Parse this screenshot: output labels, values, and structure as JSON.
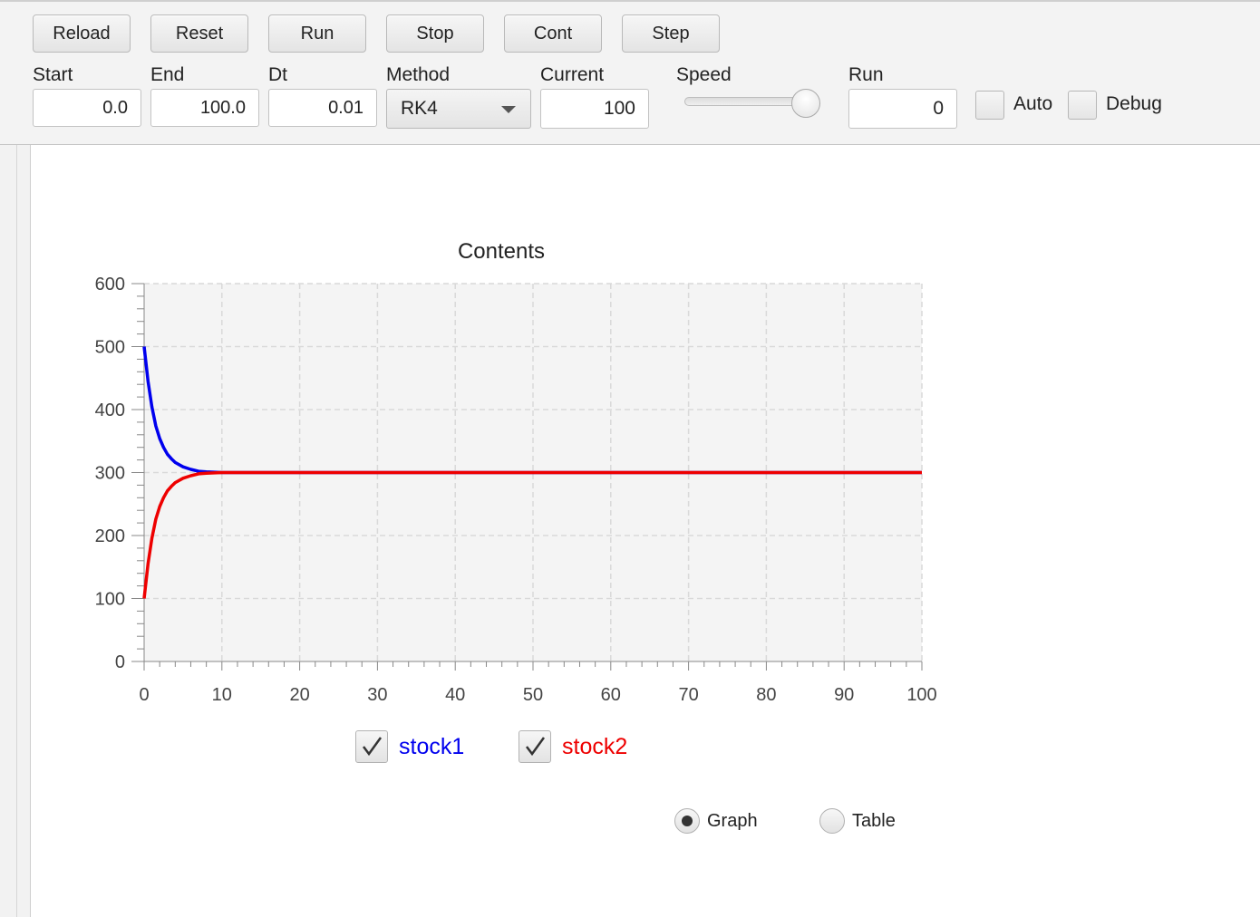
{
  "toolbar": {
    "buttons": [
      "Reload",
      "Reset",
      "Run",
      "Stop",
      "Cont",
      "Step"
    ],
    "labels": {
      "start": "Start",
      "end": "End",
      "dt": "Dt",
      "method": "Method",
      "current": "Current",
      "speed": "Speed",
      "run": "Run"
    },
    "values": {
      "start": "0.0",
      "end": "100.0",
      "dt": "0.01",
      "method": "RK4",
      "current": "100",
      "run": "0"
    },
    "speed_level": 1.0,
    "auto_label": "Auto",
    "debug_label": "Debug",
    "auto_checked": false,
    "debug_checked": false
  },
  "chart_data": {
    "type": "line",
    "title": "Contents",
    "xlabel": "",
    "ylabel": "",
    "xlim": [
      0,
      100
    ],
    "ylim": [
      0,
      600
    ],
    "xticks": [
      "0",
      "10",
      "20",
      "30",
      "40",
      "50",
      "60",
      "70",
      "80",
      "90",
      "100"
    ],
    "yticks": [
      "0",
      "100",
      "200",
      "300",
      "400",
      "500",
      "600"
    ],
    "grid": true,
    "series": [
      {
        "name": "stock1",
        "color": "#0000ee",
        "x": [
          0,
          0.5,
          1,
          1.5,
          2,
          2.5,
          3,
          3.5,
          4,
          5,
          6,
          7,
          8,
          10,
          12,
          20,
          40,
          60,
          80,
          100
        ],
        "values": [
          500,
          445,
          404,
          374,
          354,
          340,
          329,
          322,
          316,
          309,
          305,
          302,
          301,
          300,
          300,
          300,
          300,
          300,
          300,
          300
        ]
      },
      {
        "name": "stock2",
        "color": "#ee0000",
        "x": [
          0,
          0.5,
          1,
          1.5,
          2,
          2.5,
          3,
          3.5,
          4,
          5,
          6,
          7,
          8,
          10,
          12,
          20,
          40,
          60,
          80,
          100
        ],
        "values": [
          100,
          155,
          196,
          226,
          246,
          260,
          271,
          278,
          284,
          291,
          295,
          298,
          299,
          300,
          300,
          300,
          300,
          300,
          300,
          300
        ]
      }
    ],
    "legend_checked": [
      true,
      true
    ]
  },
  "view": {
    "graph_label": "Graph",
    "table_label": "Table",
    "selected": "Graph"
  }
}
